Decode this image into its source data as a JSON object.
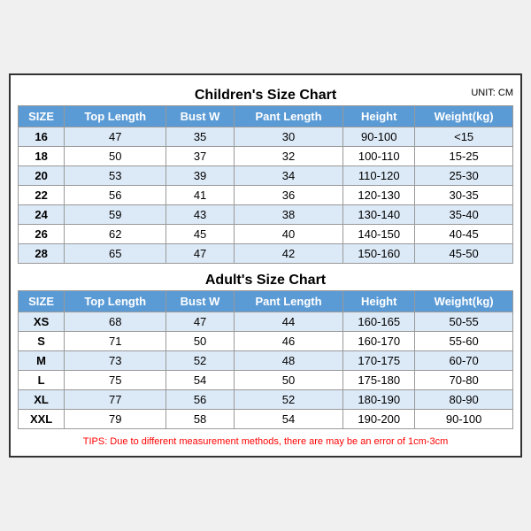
{
  "children": {
    "title": "Children's Size Chart",
    "unit": "UNIT: CM",
    "headers": [
      "SIZE",
      "Top Length",
      "Bust W",
      "Pant Length",
      "Height",
      "Weight(kg)"
    ],
    "rows": [
      [
        "16",
        "47",
        "35",
        "30",
        "90-100",
        "<15"
      ],
      [
        "18",
        "50",
        "37",
        "32",
        "100-110",
        "15-25"
      ],
      [
        "20",
        "53",
        "39",
        "34",
        "110-120",
        "25-30"
      ],
      [
        "22",
        "56",
        "41",
        "36",
        "120-130",
        "30-35"
      ],
      [
        "24",
        "59",
        "43",
        "38",
        "130-140",
        "35-40"
      ],
      [
        "26",
        "62",
        "45",
        "40",
        "140-150",
        "40-45"
      ],
      [
        "28",
        "65",
        "47",
        "42",
        "150-160",
        "45-50"
      ]
    ]
  },
  "adult": {
    "title": "Adult's Size Chart",
    "headers": [
      "SIZE",
      "Top Length",
      "Bust W",
      "Pant Length",
      "Height",
      "Weight(kg)"
    ],
    "rows": [
      [
        "XS",
        "68",
        "47",
        "44",
        "160-165",
        "50-55"
      ],
      [
        "S",
        "71",
        "50",
        "46",
        "160-170",
        "55-60"
      ],
      [
        "M",
        "73",
        "52",
        "48",
        "170-175",
        "60-70"
      ],
      [
        "L",
        "75",
        "54",
        "50",
        "175-180",
        "70-80"
      ],
      [
        "XL",
        "77",
        "56",
        "52",
        "180-190",
        "80-90"
      ],
      [
        "XXL",
        "79",
        "58",
        "54",
        "190-200",
        "90-100"
      ]
    ]
  },
  "tips": "TIPS: Due to different measurement methods, there are may be an error of 1cm-3cm"
}
